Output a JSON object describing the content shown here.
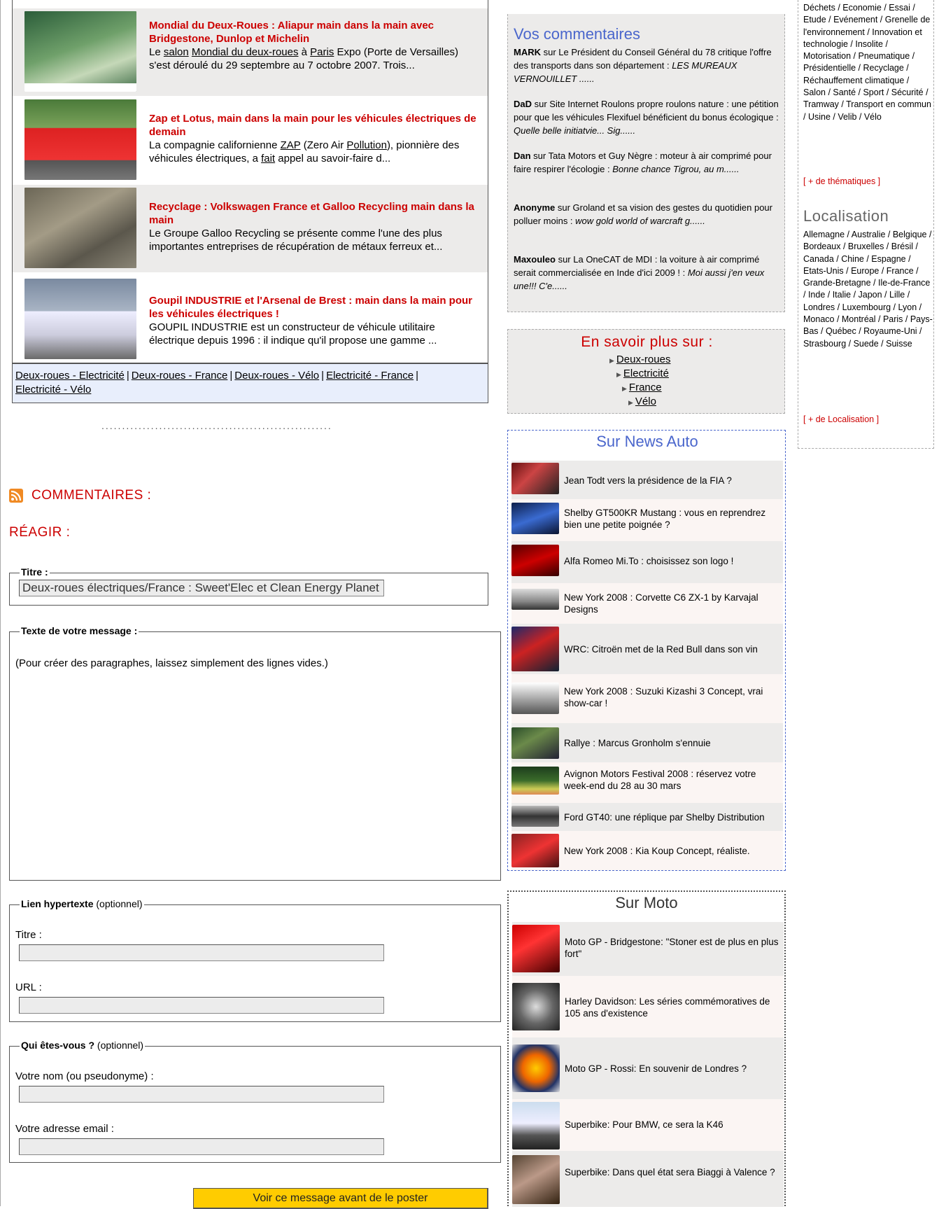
{
  "related": {
    "items": [
      {
        "title": "Mondial du Deux-Roues : Aliapur main dans la main avec Bridgestone, Dunlop et Michelin",
        "t1": "Le ",
        "l1": "salon",
        "t2": " ",
        "l2": "Mondial du deux-roues",
        "t3": " à ",
        "l3": "Paris",
        "t4": " Expo (Porte de Versailles) s'est déroulé du 29 septembre au 7 octobre 2007. Trois..."
      },
      {
        "title": "Zap et Lotus, main dans la main pour les véhicules électriques de demain",
        "t1": "La compagnie californienne ",
        "l1": "ZAP",
        "t2": " (Zero Air ",
        "l2": "Pollution",
        "t3": "), pionnière des véhicules électriques, a ",
        "l3": "fait",
        "t4": " appel au savoir-faire d..."
      },
      {
        "title": "Recyclage : Volkswagen France et Galloo Recycling main dans la main",
        "desc": "Le Groupe Galloo Recycling se présente comme l'une des plus importantes entreprises de récupération de métaux ferreux et..."
      },
      {
        "title": "Goupil INDUSTRIE et l'Arsenal de Brest : main dans la main pour les véhicules électriques !",
        "desc": "GOUPIL INDUSTRIE est un constructeur de véhicule utilitaire électrique depuis 1996 : il indique qu'il propose une gamme ..."
      }
    ],
    "tags": [
      "Deux-roues - Electricité",
      "Deux-roues - France",
      "Deux-roues - Vélo",
      "Electricité - France",
      "Electricité - Vélo"
    ],
    "tag_sep": "|"
  },
  "divider": "........................................................",
  "comments_heading": "COMMENTAIRES :",
  "react_heading": "RÉAGIR :",
  "form": {
    "title_legend": "Titre :",
    "title_value": "Deux-roues électriques/France : Sweet'Elec et Clean Energy Planet",
    "message_legend": "Texte de votre message :",
    "message_hint": "(Pour créer des paragraphes, laissez simplement des lignes vides.)",
    "link_legend_bold": "Lien hypertexte",
    "link_legend_rest": " (optionnel)",
    "link_title_label": "Titre :",
    "link_url_label": "URL :",
    "who_legend_bold": "Qui êtes-vous ?",
    "who_legend_rest": " (optionnel)",
    "name_label": "Votre nom (ou pseudonyme) :",
    "email_label": "Votre adresse email :",
    "preview_button": "Voir ce message avant de le poster"
  },
  "vos_commentaires": {
    "title": "Vos commentaires",
    "items": [
      {
        "author": "MARK",
        "text": " sur Le Président du Conseil Général du 78 critique l'offre des transports dans son département : ",
        "excerpt": "LES MUREAUX  VERNOUILLET ......"
      },
      {
        "author": "DaD",
        "text": " sur Site Internet Roulons propre roulons nature : une pétition pour que les véhicules Flexifuel bénéficient du bonus écologique : ",
        "excerpt": "Quelle belle initiatvie... Sig......"
      },
      {
        "author": "Dan",
        "text": " sur Tata Motors et Guy Nègre : moteur à air comprimé pour faire respirer l'écologie : ",
        "excerpt": "Bonne chance Tigrou, au m......"
      },
      {
        "author": "Anonyme",
        "text": " sur Groland et sa vision des gestes du quotidien pour polluer moins : ",
        "excerpt": "wow gold world of warcraft g......"
      },
      {
        "author": "Maxouleo",
        "text": " sur La OneCAT de MDI : la voiture à air comprimé serait commercialisée en Inde d'ici 2009 ! : ",
        "excerpt": "Moi aussi j'en veux une!!! C'e......"
      }
    ]
  },
  "savoir": {
    "title": "En savoir plus sur :",
    "items": [
      "Deux-roues",
      "Electricité",
      "France",
      "Vélo"
    ]
  },
  "news_auto": {
    "title": "Sur News Auto",
    "items": [
      "Jean Todt vers la présidence de la FIA ?",
      "Shelby GT500KR Mustang : vous en reprendrez bien une petite poignée ?",
      "Alfa Romeo Mi.To : choisissez son logo !",
      "New York 2008 : Corvette C6 ZX-1 by Karvajal Designs",
      "WRC: Citroën met de la Red Bull dans son vin",
      "New York 2008 : Suzuki Kizashi 3 Concept, vrai show-car !",
      "Rallye : Marcus Gronholm s'ennuie",
      "Avignon Motors Festival 2008 : réservez votre week-end du 28 au 30 mars",
      "Ford GT40: une réplique par Shelby Distribution",
      "New York 2008 : Kia Koup Concept, réaliste."
    ]
  },
  "moto": {
    "title": "Sur Moto",
    "items": [
      "Moto GP - Bridgestone: \"Stoner est de plus en plus fort\"",
      "Harley Davidson: Les séries commémoratives de 105 ans d'existence",
      "Moto GP - Rossi: En souvenir de Londres ?",
      "Superbike: Pour BMW, ce sera la K46",
      "Superbike: Dans quel état sera Biaggi à Valence ?"
    ]
  },
  "themes": {
    "text": "Déchets /  Economie /  Essai /  Etude /  Evénement /  Grenelle de l'environnement /  Innovation et technologie /  Insolite /  Motorisation /  Pneumatique /  Présidentielle /  Recyclage /  Réchauffement climatique /  Salon /  Santé /  Sport /  Sécurité /  Tramway /  Transport en commun /  Usine /  Velib /  Vélo",
    "more": "[ + de thématiques ]"
  },
  "localisation": {
    "title": "Localisation",
    "text": "Allemagne /  Australie /  Belgique /  Bordeaux /  Bruxelles /  Brésil /  Canada /  Chine /  Espagne /  Etats-Unis /  Europe /  France /  Grande-Bretagne /  Ile-de-France /  Inde /  Italie /  Japon /  Lille /  Londres /  Luxembourg /  Lyon /  Monaco /  Montréal /  Paris /  Pays-Bas /  Québec /  Royaume-Uni /  Strasbourg /  Suede /  Suisse",
    "more": "[ + de Localisation ]"
  },
  "colors": {
    "accent_red": "#cc0000",
    "accent_blue": "#4a66cc",
    "button_yellow": "#ffcc00",
    "panel_grey": "#ecebea"
  }
}
